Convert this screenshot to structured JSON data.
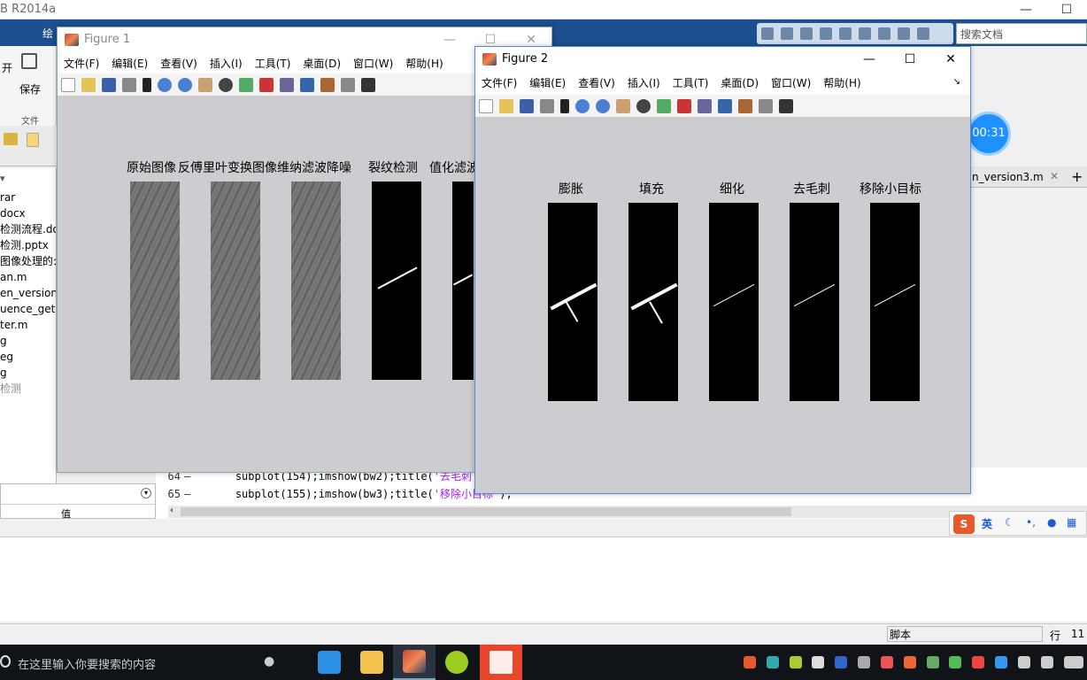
{
  "matlab": {
    "title_fragment": "B R2014a",
    "qa_search_placeholder": "搜索文档",
    "ribbon_label_top": "绘",
    "ribbon_open": "开",
    "ribbon_save": "保存",
    "ribbon_section": "文件",
    "tab_visible": "n_version3.m",
    "file_items": [
      "rar",
      "docx",
      "检测流程.do",
      "检测.pptx",
      "图像处理的么",
      "an.m",
      "en_version",
      "uence_get.m",
      "ter.m",
      "g",
      "eg",
      "g",
      "检测"
    ],
    "workspace_value_header": "值",
    "code": [
      {
        "line": "64",
        "prefix": "subplot(154);imshow(bw2);title(",
        "string": "'去毛刺",
        "suffix": ""
      },
      {
        "line": "65",
        "prefix": "subplot(155);imshow(bw3);title(",
        "string": "'移除小目标",
        "suffix": "');"
      }
    ],
    "status": {
      "script_label": "脚本",
      "row_label": "行",
      "row_value": "11"
    },
    "timer": "00:31",
    "ime_label": "英"
  },
  "figure1": {
    "title": "Figure 1",
    "menu": [
      "文件(F)",
      "编辑(E)",
      "查看(V)",
      "插入(I)",
      "工具(T)",
      "桌面(D)",
      "窗口(W)",
      "帮助(H)"
    ],
    "subplots": [
      "原始图像",
      "反傅里叶变换图像",
      "维纳滤波降噪",
      "裂纹检测",
      "值化滤波"
    ]
  },
  "figure2": {
    "title": "Figure 2",
    "menu": [
      "文件(F)",
      "编辑(E)",
      "查看(V)",
      "插入(I)",
      "工具(T)",
      "桌面(D)",
      "窗口(W)",
      "帮助(H)"
    ],
    "subplots": [
      "膨胀",
      "填充",
      "细化",
      "去毛刺",
      "移除小目标"
    ]
  },
  "taskbar": {
    "search_placeholder": "在这里输入你要搜索的内容"
  },
  "icons": {
    "colors": {
      "taskbar": "#101418",
      "matlab_blue": "#1b4f8f",
      "timer": "#1e90ff",
      "figure_bg": "#cdccd0"
    }
  }
}
